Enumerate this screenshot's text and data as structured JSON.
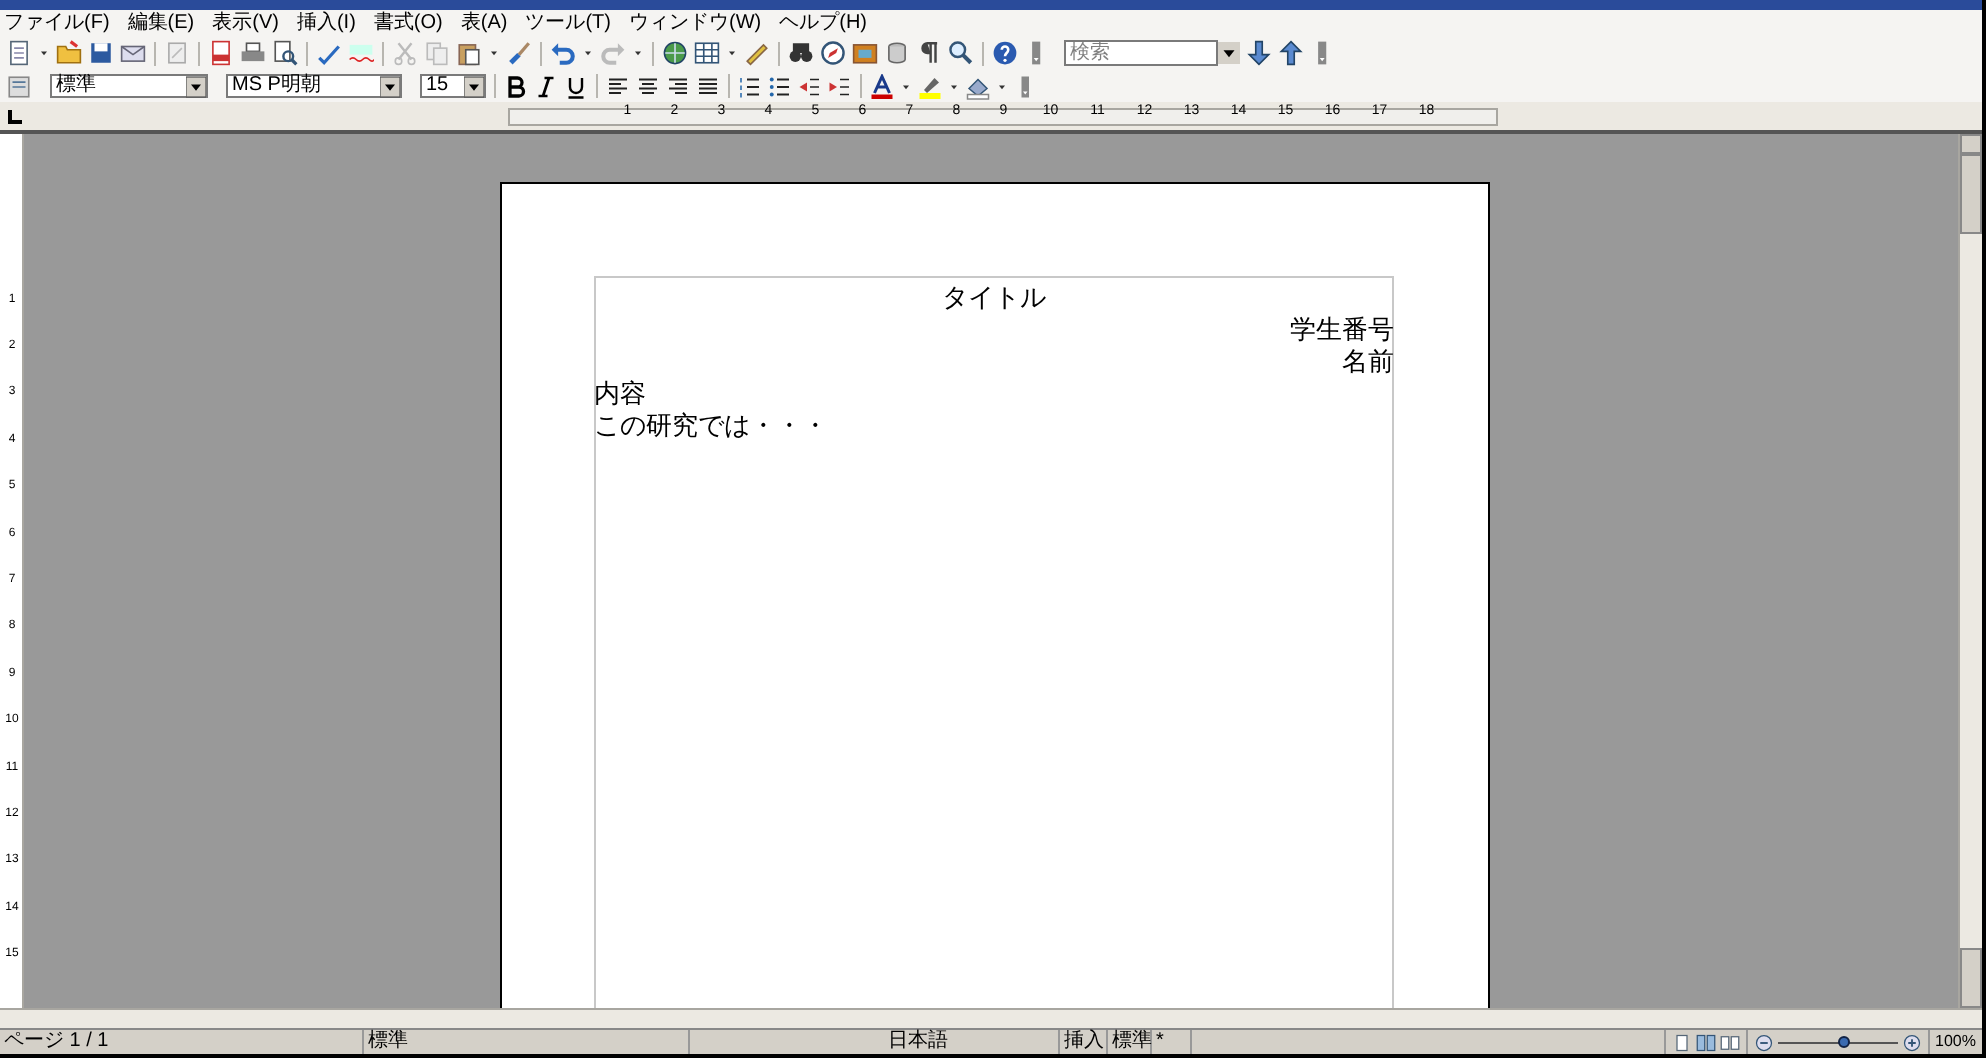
{
  "menu": [
    "ファイル(F)",
    "編集(E)",
    "表示(V)",
    "挿入(I)",
    "書式(O)",
    "表(A)",
    "ツール(T)",
    "ウィンドウ(W)",
    "ヘルプ(H)"
  ],
  "toolbar_standard": {
    "search": {
      "placeholder": "検索"
    }
  },
  "toolbar_formatting": {
    "style": "標準",
    "font": "MS P明朝",
    "size": "15"
  },
  "ruler": {
    "horizontal": [
      "1",
      "2",
      "3",
      "4",
      "5",
      "6",
      "7",
      "8",
      "9",
      "10",
      "11",
      "12",
      "13",
      "14",
      "15",
      "16",
      "17",
      "18"
    ],
    "vertical": [
      "1",
      "2",
      "3",
      "4",
      "5",
      "6",
      "7",
      "8",
      "9",
      "10",
      "11",
      "12",
      "13",
      "14",
      "15"
    ]
  },
  "document": {
    "paragraphs": [
      {
        "text": "タイトル",
        "kind": "heading"
      },
      {
        "text": "学生番号",
        "kind": "author"
      },
      {
        "text": "名前",
        "kind": "author"
      },
      {
        "text": "内容",
        "kind": "body"
      },
      {
        "text": "この研究では・・・",
        "kind": "body"
      }
    ]
  },
  "status_bar": {
    "page": "ページ 1 / 1",
    "style": "標準",
    "language": "日本語",
    "mode": "挿入",
    "selection_mode": "標準",
    "modified": "*",
    "zoom": {
      "level": 0.55
    },
    "zoom_text": "100%"
  }
}
